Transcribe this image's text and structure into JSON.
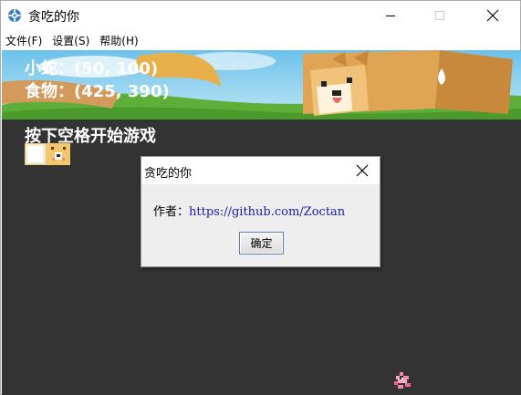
{
  "window": {
    "title": "贪吃的你",
    "icon": "gear-icon",
    "controls": [
      "minimize-icon",
      "maximize-icon",
      "close-icon"
    ]
  },
  "menu": {
    "items": [
      {
        "label": "文件(F)"
      },
      {
        "label": "设置(S)"
      },
      {
        "label": "帮助(H)"
      }
    ]
  },
  "hud": {
    "snake_label": "小蛇：(50, 100)",
    "food_label": "食物：(425, 390)",
    "hint": "按下空格开始游戏"
  },
  "dialog": {
    "title": "贪吃的你",
    "message_prefix": "作者：",
    "message_link": "https://github.com/Zoctan",
    "ok_label": "确定"
  },
  "colors": {
    "game_background": "#333333",
    "hud_text": "#ffffff",
    "link": "#1a1aa6"
  }
}
